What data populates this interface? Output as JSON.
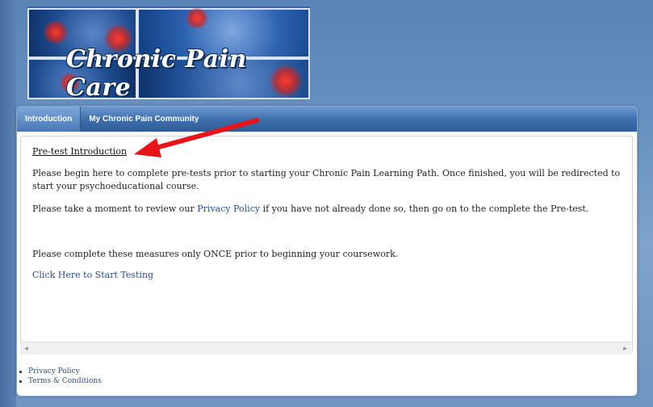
{
  "banner": {
    "title": "Chronic Pain Care"
  },
  "tabs": [
    {
      "label": "Introduction"
    },
    {
      "label": "My Chronic Pain Community"
    }
  ],
  "main": {
    "heading": "Pre-test Introduction",
    "para1": "Please begin here to complete pre-tests prior to starting your Chronic Pain Learning Path. Once finished, you will be redirected to start your psychoeducational course.",
    "para2_before": "Please take a moment to review our ",
    "para2_link": "Privacy Policy",
    "para2_after": " if you have not already done so, then go on to the complete the Pre-test.",
    "para3": "Please complete these measures only ONCE prior to beginning your coursework.",
    "start_link": "Click Here to Start Testing"
  },
  "scrollbar": {
    "left_icon": "◂",
    "right_icon": "▸"
  },
  "footer": {
    "links": [
      "Privacy Policy",
      "Terms & Conditions"
    ]
  },
  "colors": {
    "accent_red": "#e8141a",
    "link_blue": "#2a4f8f",
    "tab_blue": "#3f6fad"
  }
}
